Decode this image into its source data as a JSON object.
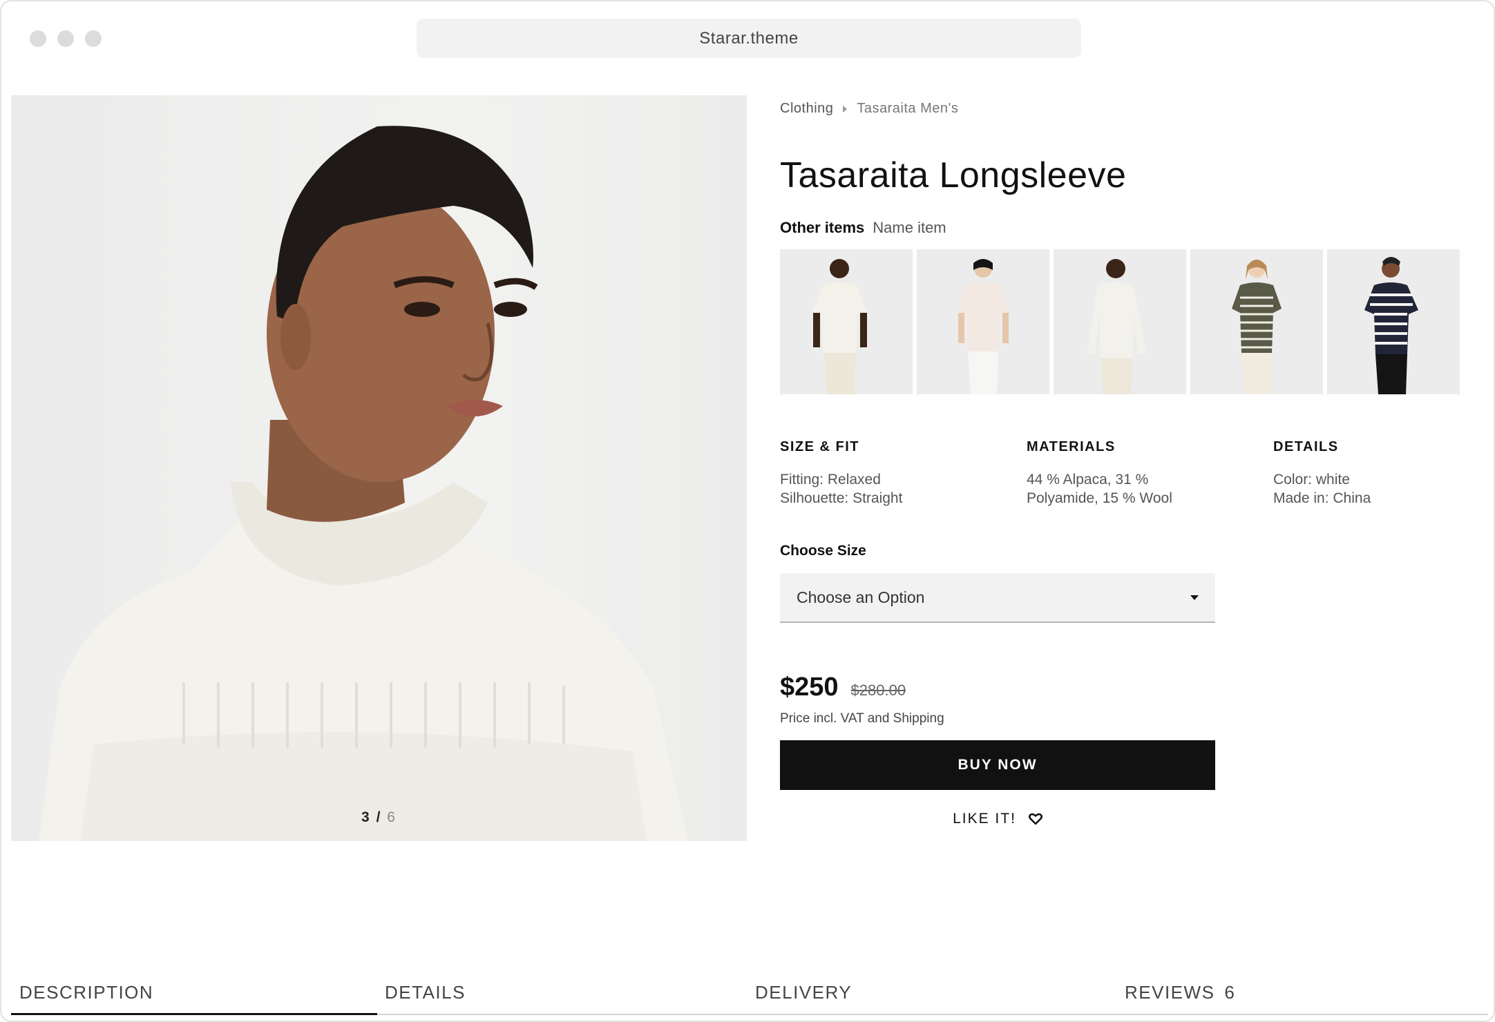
{
  "browser": {
    "url": "Starar.theme"
  },
  "gallery": {
    "current": "3",
    "separator": "/",
    "total": "6",
    "progress_fraction": 0.5
  },
  "breadcrumb": [
    "Clothing",
    "Tasaraita Men's"
  ],
  "product": {
    "title": "Tasaraita Longsleeve",
    "other_items_label": "Other items",
    "other_items_value": "Name item"
  },
  "specs": [
    {
      "heading": "SIZE & FIT",
      "lines": [
        "Fitting: Relaxed",
        "Silhouette: Straight"
      ]
    },
    {
      "heading": "MATERIALS",
      "lines": [
        "44 % Alpaca, 31 %",
        "Polyamide, 15 % Wool"
      ]
    },
    {
      "heading": "DETAILS",
      "lines": [
        "Color: white",
        "Made in: China"
      ]
    }
  ],
  "size": {
    "label": "Choose Size",
    "placeholder": "Choose an Option"
  },
  "pricing": {
    "price": "$250",
    "old_price": "$280.00",
    "note": "Price incl. VAT and Shipping"
  },
  "actions": {
    "buy": "BUY NOW",
    "like": "LIKE IT!"
  },
  "tabs": [
    {
      "label": "DESCRIPTION",
      "count": ""
    },
    {
      "label": "DETAILS",
      "count": ""
    },
    {
      "label": "DELIVERY",
      "count": ""
    },
    {
      "label": "REVIEWS",
      "count": "6"
    }
  ],
  "colors": {
    "accent": "#111111",
    "muted_text": "#555555",
    "panel_bg": "#f2f2f2",
    "window_dot": "#dcdcdc"
  },
  "icons": {
    "breadcrumb_separator": "chevron-right-icon",
    "select_caret": "caret-down-icon",
    "like": "heart-icon"
  }
}
